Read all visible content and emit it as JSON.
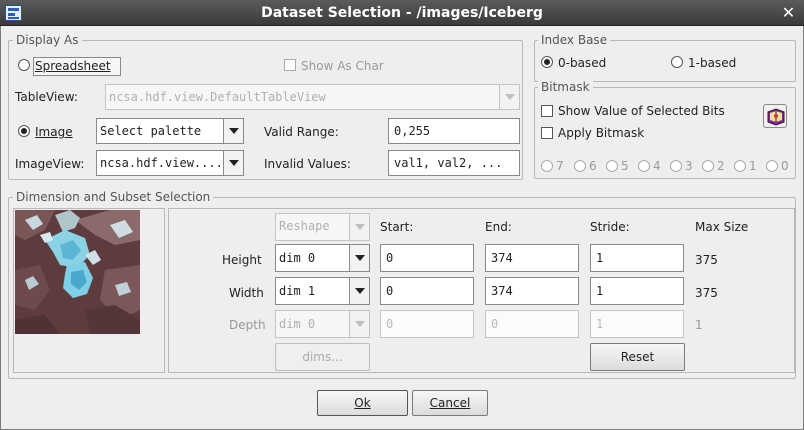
{
  "window": {
    "title": "Dataset Selection - /images/Iceberg",
    "close_glyph": "✕"
  },
  "display_as": {
    "legend": "Display As",
    "spreadsheet_label": "Spreadsheet",
    "show_as_char_label": "Show As Char",
    "tableview_label": "TableView:",
    "tableview_value": "ncsa.hdf.view.DefaultTableView",
    "image_label": "Image",
    "palette_value": "Select palette",
    "imageview_label": "ImageView:",
    "imageview_value": "ncsa.hdf.view....",
    "valid_range_label": "Valid Range:",
    "valid_range_value": "0,255",
    "invalid_values_label": "Invalid Values:",
    "invalid_values_value": "val1, val2, ..."
  },
  "index_base": {
    "legend": "Index Base",
    "zero_based": "0-based",
    "one_based": "1-based"
  },
  "bitmask": {
    "legend": "Bitmask",
    "show_value_label": "Show Value of Selected Bits",
    "apply_bitmask_label": "Apply Bitmask",
    "bits": [
      "7",
      "6",
      "5",
      "4",
      "3",
      "2",
      "1",
      "0"
    ]
  },
  "dimension": {
    "legend": "Dimension and Subset Selection",
    "reshape": "Reshape",
    "start_header": "Start:",
    "end_header": "End:",
    "stride_header": "Stride:",
    "max_size_header": "Max Size",
    "rows": [
      {
        "label": "Height",
        "dim": "dim 0",
        "start": "0",
        "end": "374",
        "stride": "1",
        "max": "375"
      },
      {
        "label": "Width",
        "dim": "dim 1",
        "start": "0",
        "end": "374",
        "stride": "1",
        "max": "375"
      },
      {
        "label": "Depth",
        "dim": "dim 0",
        "start": "0",
        "end": "0",
        "stride": "1",
        "max": "1"
      }
    ],
    "dims_button": "dims...",
    "reset_button": "Reset"
  },
  "buttons": {
    "ok": "Ok",
    "cancel": "Cancel"
  },
  "colors": {
    "titlebar": "#4a4a4a",
    "window_bg": "#eeeeee",
    "ice": "#7fd0e6",
    "rock": "#5a3a3c"
  }
}
